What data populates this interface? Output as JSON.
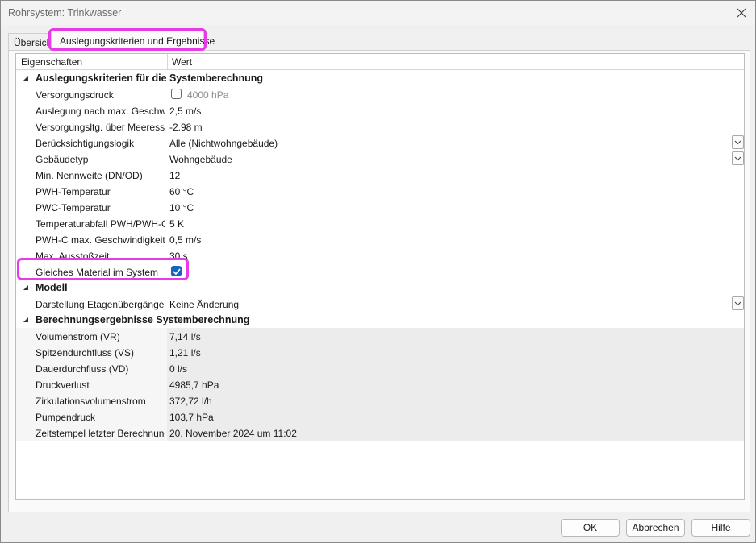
{
  "window": {
    "title": "Rohrsystem: Trinkwasser"
  },
  "tabs": [
    {
      "label": "Übersicht"
    },
    {
      "label": "Auslegungskriterien und Ergebnisse"
    }
  ],
  "grid": {
    "headers": {
      "name": "Eigenschaften",
      "value": "Wert"
    },
    "categories": {
      "design": "Auslegungskriterien für die Systemberechnung",
      "model": "Modell",
      "results": "Berechnungsergebnisse Systemberechnung"
    },
    "design_rows": [
      {
        "name": "Versorgungsdruck",
        "value": "4000 hPa",
        "checkbox": false
      },
      {
        "name": "Auslegung nach max. Geschwi...",
        "value": "2,5 m/s"
      },
      {
        "name": "Versorgungsltg. über Meeresspi...",
        "value": "-2.98 m"
      },
      {
        "name": "Berücksichtigungslogik",
        "value": "Alle (Nichtwohngebäude)"
      },
      {
        "name": "Gebäudetyp",
        "value": "Wohngebäude"
      },
      {
        "name": "Min. Nennweite (DN/OD)",
        "value": "12"
      },
      {
        "name": "PWH-Temperatur",
        "value": "60 °C"
      },
      {
        "name": "PWC-Temperatur",
        "value": "10 °C"
      },
      {
        "name": "Temperaturabfall PWH/PWH-C",
        "value": "5 K"
      },
      {
        "name": "PWH-C max. Geschwindigkeit",
        "value": "0,5 m/s"
      },
      {
        "name": "Max. Ausstoßzeit",
        "value": "30 s"
      },
      {
        "name": "Gleiches Material im System",
        "value": "",
        "checkbox": true
      }
    ],
    "model_rows": [
      {
        "name": "Darstellung Etagenübergänge",
        "value": "Keine Änderung"
      }
    ],
    "result_rows": [
      {
        "name": "Volumenstrom (VR)",
        "value": "7,14 l/s"
      },
      {
        "name": "Spitzendurchfluss (VS)",
        "value": "1,21 l/s"
      },
      {
        "name": "Dauerdurchfluss (VD)",
        "value": "0 l/s"
      },
      {
        "name": "Druckverlust",
        "value": "4985,7 hPa"
      },
      {
        "name": "Zirkulationsvolumenstrom",
        "value": "372,72 l/h"
      },
      {
        "name": "Pumpendruck",
        "value": "103,7 hPa"
      },
      {
        "name": "Zeitstempel letzter Berechnung",
        "value": "20. November 2024 um 11:02"
      }
    ]
  },
  "buttons": {
    "ok": "OK",
    "cancel": "Abbrechen",
    "help": "Hilfe"
  },
  "colors": {
    "highlight": "#e63ce6",
    "checkbox_checked": "#1565c0"
  }
}
